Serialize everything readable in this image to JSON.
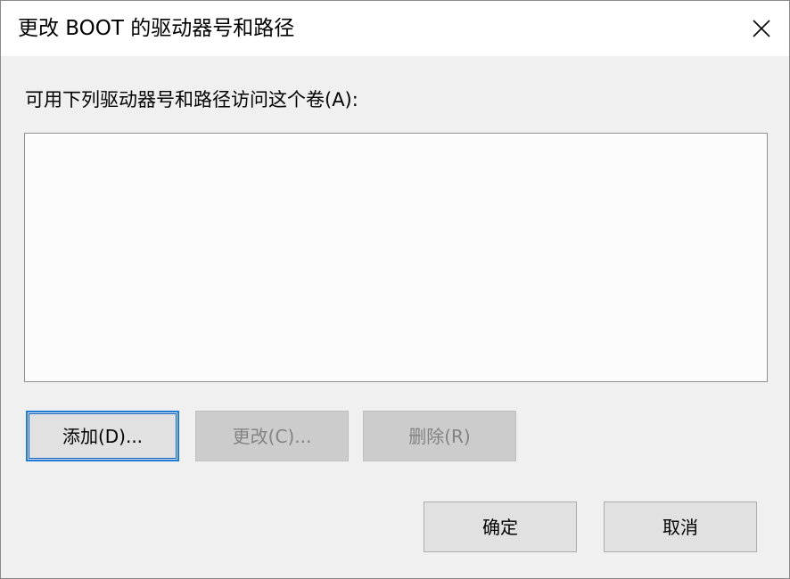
{
  "window": {
    "title": "更改 BOOT 的驱动器号和路径"
  },
  "main": {
    "prompt": "可用下列驱动器号和路径访问这个卷(A):",
    "list_items": []
  },
  "buttons": {
    "add": "添加(D)...",
    "change": "更改(C)...",
    "delete": "删除(R)",
    "ok": "确定",
    "cancel": "取消"
  },
  "icons": {
    "close": "close-icon"
  },
  "colors": {
    "focus_border": "#1e7ad8",
    "background": "#f0f0f0",
    "disabled_text": "#838383"
  }
}
